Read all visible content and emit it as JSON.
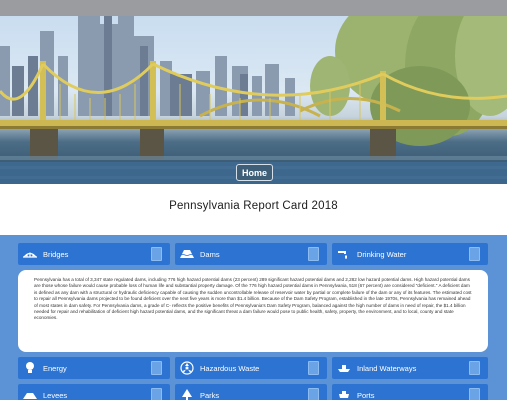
{
  "header": {
    "home_label": "Home"
  },
  "page": {
    "title": "Pennsylvania Report Card 2018"
  },
  "categories_row1": [
    {
      "label": "Bridges",
      "icon": "bridge-icon"
    },
    {
      "label": "Dams",
      "icon": "dam-icon"
    },
    {
      "label": "Drinking Water",
      "icon": "faucet-icon"
    }
  ],
  "categories_row2": [
    {
      "label": "Energy",
      "icon": "bulb-icon"
    },
    {
      "label": "Hazardous Waste",
      "icon": "hazard-icon"
    },
    {
      "label": "Inland Waterways",
      "icon": "ship-icon"
    }
  ],
  "categories_row3": [
    {
      "label": "Levees",
      "icon": "levee-icon"
    },
    {
      "label": "Parks",
      "icon": "tree-icon"
    },
    {
      "label": "Ports",
      "icon": "anchor-icon"
    }
  ],
  "info": {
    "text": "Pennsylvania has a total of 3,347 state regulated dams, including 776 high hazard potential dams (23 percent) 289 significant hazard potential dams and 2,282 low hazard potential dams. High hazard potential dams are those whose failure would cause probable loss of human life and substantial property damage. Of the 776 high hazard potential dams in Pennsylvania, 518 (67 percent) are considered \"deficient.\" A deficient dam is defined as any dam with a structural or hydraulic deficiency capable of causing the sudden uncontrollable release of reservoir water by partial or complete failure of the dam or any of its features. The estimated cost to repair all Pennsylvania dams projected to be found deficient over the next five years is more than $1.4 billion. Because of the Dam Safety Program, established in the late 1970s, Pennsylvania has remained ahead of most states in dam safety. For Pennsylvania dams, a grade of C- reflects the positive benefits of Pennsylvania's Dam Safety Program, balanced against the high number of dams in need of repair, the $1.4 billion needed for repair and rehabilitation of deficient high hazard potential dams, and the significant threat a dam failure would pose to public health, safety, property, the environment, and to local, county and state economies."
  },
  "colors": {
    "panel": "#5b93d6",
    "tile": "#2d74d2",
    "badge": "#6aa4e6"
  }
}
